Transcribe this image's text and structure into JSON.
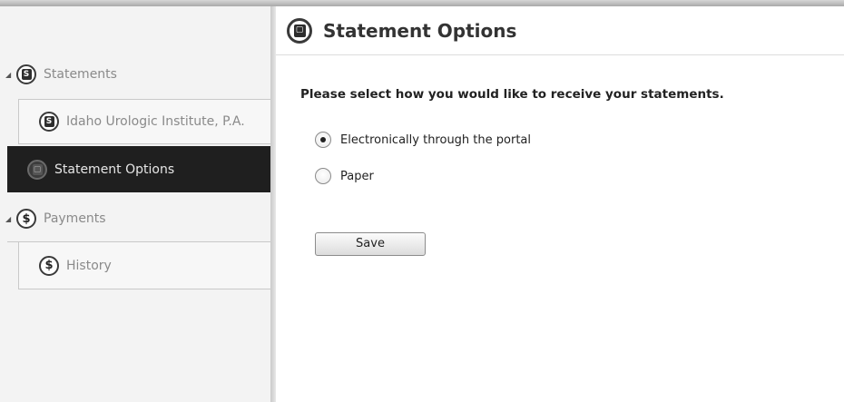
{
  "sidebar": {
    "statements_label": "Statements",
    "idaho_label": "Idaho Urologic Institute, P.A.",
    "statement_options_label": "Statement Options",
    "payments_label": "Payments",
    "history_label": "History",
    "icons": {
      "statements": "statement-icon",
      "idaho": "statement-icon",
      "statement_options": "options-icon",
      "payments": "dollar-icon",
      "history": "dollar-icon"
    }
  },
  "header": {
    "title": "Statement Options",
    "icon": "options-icon"
  },
  "main": {
    "prompt": "Please select how you would like to receive your statements.",
    "options": [
      {
        "label": "Electronically through the portal",
        "selected": true
      },
      {
        "label": "Paper",
        "selected": false
      }
    ],
    "save_label": "Save"
  }
}
